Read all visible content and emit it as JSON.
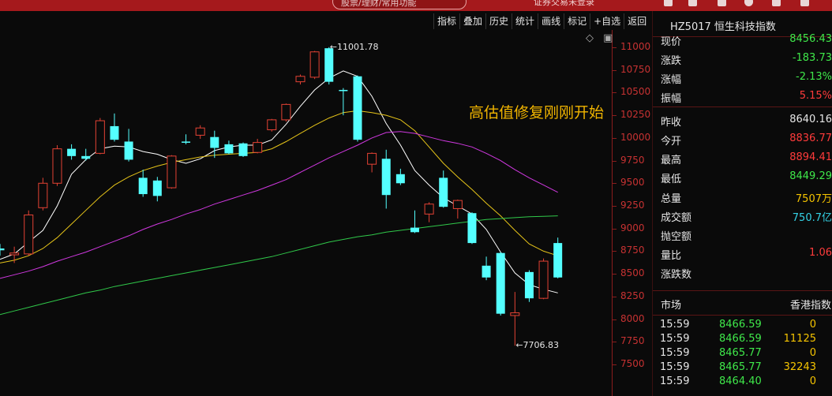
{
  "topbar": {
    "search_placeholder": "股票/理财/常用功能",
    "login_text": "证券交易未登录"
  },
  "toolbar": {
    "buttons": [
      "指标",
      "叠加",
      "历史",
      "统计",
      "画线",
      "标记",
      "+自选",
      "返回"
    ]
  },
  "window_controls": "◇ ▣",
  "annotation": "高估值修复刚刚开始",
  "colors": {
    "up": "#e34234",
    "down": "#54ffff",
    "ma5": "#ffffff",
    "ma10": "#e6c419",
    "ma20": "#d038e0",
    "ma60": "#30c84a",
    "axis": "#c73232",
    "price_green": "#3fe84a",
    "price_red": "#ff3b3b",
    "volume_yellow": "#f5c400",
    "turnover_cyan": "#34d2e6"
  },
  "chart_data": {
    "type": "candlestick",
    "ylim": [
      7350,
      11480
    ],
    "yticks": [
      7500,
      7750,
      8000,
      8250,
      8500,
      8750,
      9000,
      9250,
      9500,
      9750,
      10000,
      10250,
      10500,
      10750,
      11000
    ],
    "high_label": "11001.78",
    "low_label": "7706.83",
    "candles": [
      {
        "o": 8780,
        "h": 8830,
        "l": 8700,
        "c": 8760
      },
      {
        "o": 8710,
        "h": 8800,
        "l": 8620,
        "c": 8730
      },
      {
        "o": 8720,
        "h": 9200,
        "l": 8700,
        "c": 9150
      },
      {
        "o": 9230,
        "h": 9560,
        "l": 9200,
        "c": 9500
      },
      {
        "o": 9500,
        "h": 9920,
        "l": 9470,
        "c": 9880
      },
      {
        "o": 9880,
        "h": 9930,
        "l": 9760,
        "c": 9800
      },
      {
        "o": 9800,
        "h": 9880,
        "l": 9750,
        "c": 9770
      },
      {
        "o": 9830,
        "h": 10220,
        "l": 9820,
        "c": 10190
      },
      {
        "o": 10130,
        "h": 10270,
        "l": 9960,
        "c": 9980
      },
      {
        "o": 9960,
        "h": 10100,
        "l": 9740,
        "c": 9760
      },
      {
        "o": 9560,
        "h": 9650,
        "l": 9350,
        "c": 9380
      },
      {
        "o": 9530,
        "h": 9570,
        "l": 9300,
        "c": 9360
      },
      {
        "o": 9450,
        "h": 9810,
        "l": 9440,
        "c": 9800
      },
      {
        "o": 9960,
        "h": 10040,
        "l": 9930,
        "c": 9950
      },
      {
        "o": 10030,
        "h": 10140,
        "l": 9990,
        "c": 10110
      },
      {
        "o": 10010,
        "h": 10080,
        "l": 9780,
        "c": 9890
      },
      {
        "o": 9930,
        "h": 9970,
        "l": 9820,
        "c": 9830
      },
      {
        "o": 9940,
        "h": 9950,
        "l": 9790,
        "c": 9800
      },
      {
        "o": 9840,
        "h": 9990,
        "l": 9830,
        "c": 9950
      },
      {
        "o": 10090,
        "h": 10210,
        "l": 10070,
        "c": 10200
      },
      {
        "o": 10200,
        "h": 10380,
        "l": 10180,
        "c": 10370
      },
      {
        "o": 10620,
        "h": 10700,
        "l": 10590,
        "c": 10680
      },
      {
        "o": 10670,
        "h": 10960,
        "l": 10650,
        "c": 10950
      },
      {
        "o": 10990,
        "h": 11002,
        "l": 10590,
        "c": 10620
      },
      {
        "o": 10530,
        "h": 10550,
        "l": 10250,
        "c": 10520
      },
      {
        "o": 10680,
        "h": 10690,
        "l": 9960,
        "c": 9980
      },
      {
        "o": 9710,
        "h": 9840,
        "l": 9620,
        "c": 9830
      },
      {
        "o": 9770,
        "h": 9870,
        "l": 9220,
        "c": 9370
      },
      {
        "o": 9600,
        "h": 9660,
        "l": 9480,
        "c": 9500
      },
      {
        "o": 9010,
        "h": 9200,
        "l": 8950,
        "c": 8960
      },
      {
        "o": 9160,
        "h": 9290,
        "l": 9070,
        "c": 9270
      },
      {
        "o": 9560,
        "h": 9640,
        "l": 9230,
        "c": 9240
      },
      {
        "o": 9220,
        "h": 9320,
        "l": 9110,
        "c": 9310
      },
      {
        "o": 9170,
        "h": 9180,
        "l": 8830,
        "c": 8840
      },
      {
        "o": 8590,
        "h": 8690,
        "l": 8430,
        "c": 8460
      },
      {
        "o": 8730,
        "h": 8740,
        "l": 8040,
        "c": 8060
      },
      {
        "o": 8040,
        "h": 8300,
        "l": 7706.83,
        "c": 8070
      },
      {
        "o": 8520,
        "h": 8540,
        "l": 8190,
        "c": 8230
      },
      {
        "o": 8230,
        "h": 8670,
        "l": 8220,
        "c": 8640
      },
      {
        "o": 8840,
        "h": 8900,
        "l": 8450,
        "c": 8460
      }
    ],
    "ma_series": [
      {
        "key": "ma5",
        "values": [
          8660,
          8720,
          8850,
          8980,
          9250,
          9600,
          9760,
          9880,
          9910,
          9900,
          9850,
          9820,
          9760,
          9720,
          9770,
          9860,
          9900,
          9920,
          9920,
          9980,
          10150,
          10350,
          10530,
          10660,
          10740,
          10680,
          10460,
          10160,
          9920,
          9640,
          9480,
          9340,
          9250,
          9160,
          8990,
          8740,
          8510,
          8380,
          8330,
          8290
        ]
      },
      {
        "key": "ma10",
        "values": [
          8620,
          8650,
          8700,
          8780,
          8900,
          9050,
          9200,
          9350,
          9480,
          9570,
          9640,
          9690,
          9730,
          9760,
          9790,
          9810,
          9820,
          9830,
          9840,
          9880,
          9960,
          10050,
          10140,
          10220,
          10280,
          10300,
          10280,
          10250,
          10200,
          10080,
          9900,
          9720,
          9570,
          9430,
          9280,
          9140,
          8980,
          8830,
          8750,
          8700
        ]
      },
      {
        "key": "ma20",
        "values": [
          8450,
          8490,
          8530,
          8580,
          8640,
          8690,
          8740,
          8800,
          8860,
          8920,
          8990,
          9050,
          9100,
          9160,
          9210,
          9270,
          9320,
          9370,
          9420,
          9480,
          9540,
          9620,
          9700,
          9780,
          9850,
          9920,
          10000,
          10060,
          10070,
          10050,
          10010,
          9970,
          9940,
          9900,
          9830,
          9750,
          9650,
          9560,
          9480,
          9400
        ]
      },
      {
        "key": "ma60",
        "values": [
          8050,
          8090,
          8130,
          8170,
          8210,
          8250,
          8290,
          8320,
          8360,
          8390,
          8420,
          8450,
          8480,
          8510,
          8540,
          8570,
          8600,
          8630,
          8660,
          8690,
          8730,
          8770,
          8810,
          8850,
          8880,
          8910,
          8930,
          8960,
          8980,
          9000,
          9020,
          9040,
          9060,
          9080,
          9100,
          9110,
          9120,
          9130,
          9135,
          9140
        ]
      }
    ]
  },
  "panel": {
    "title": "HZ5017 恒生科技指数",
    "rows": [
      {
        "label": "现价",
        "value": "8456.43",
        "color": "#3fe84a"
      },
      {
        "label": "涨跌",
        "value": "-183.73",
        "color": "#3fe84a"
      },
      {
        "label": "涨幅",
        "value": "-2.13%",
        "color": "#3fe84a"
      },
      {
        "label": "振幅",
        "value": "5.15%",
        "color": "#ff3b3b"
      },
      {
        "label": "昨收",
        "value": "8640.16",
        "color": "#e6e6e6"
      },
      {
        "label": "今开",
        "value": "8836.77",
        "color": "#ff3b3b"
      },
      {
        "label": "最高",
        "value": "8894.41",
        "color": "#ff3b3b"
      },
      {
        "label": "最低",
        "value": "8449.29",
        "color": "#3fe84a"
      },
      {
        "label": "总量",
        "value": "7507万",
        "color": "#f5c400"
      },
      {
        "label": "成交额",
        "value": "750.7亿",
        "color": "#34d2e6"
      },
      {
        "label": "抛空额",
        "value": "",
        "color": "#e6e6e6"
      },
      {
        "label": "量比",
        "value": "1.06",
        "color": "#ff3b3b"
      },
      {
        "label": "涨跌数",
        "value": "",
        "color": "#e6e6e6"
      }
    ],
    "market_label": "市场",
    "market_value": "香港指数",
    "ticks": [
      {
        "time": "15:59",
        "price": "8466.59",
        "volume": "0"
      },
      {
        "time": "15:59",
        "price": "8466.59",
        "volume": "11125"
      },
      {
        "time": "15:59",
        "price": "8465.77",
        "volume": "0"
      },
      {
        "time": "15:59",
        "price": "8465.77",
        "volume": "32243"
      },
      {
        "time": "15:59",
        "price": "8464.40",
        "volume": "0"
      }
    ]
  }
}
